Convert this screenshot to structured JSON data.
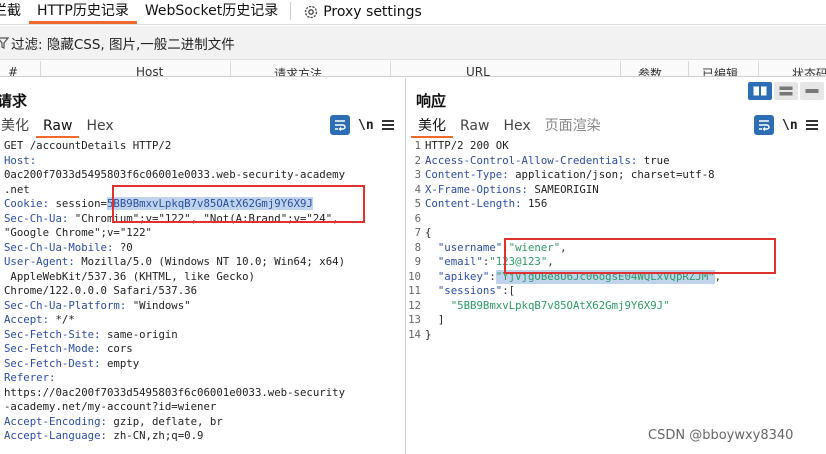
{
  "tabs": [
    {
      "label": "拦截"
    },
    {
      "label": "HTTP历史记录"
    },
    {
      "label": "WebSocket历史记录"
    },
    {
      "label": "Proxy settings"
    }
  ],
  "filter": {
    "text": "过滤: 隐藏CSS, 图片,一般二进制文件"
  },
  "columns": {
    "num": "#",
    "host": "Host",
    "method": "请求方法",
    "url": "URL",
    "params": "参数",
    "edited": "已编辑",
    "status": "状态码"
  },
  "request": {
    "title": "请求",
    "subtabs": [
      "美化",
      "Raw",
      "Hex"
    ],
    "nl_label": "\\n",
    "lines": [
      {
        "text": "GET /accountDetails HTTP/2"
      },
      {
        "name": "Host:",
        "value": ""
      },
      {
        "text": "0ac200f7033d5495803f6c06001e0033.web-security-academy"
      },
      {
        "text": ".net"
      },
      {
        "name": "Cookie:",
        "value": " session=",
        "highlight": "5BB9BmxvLpkqB7v85OAtX62Gmj9Y6X9J"
      },
      {
        "name": "Sec-Ch-Ua:",
        "value": " \"Chromium\";v=\"122\", \"Not(A:Brand\";v=\"24\","
      },
      {
        "text": "\"Google Chrome\";v=\"122\""
      },
      {
        "name": "Sec-Ch-Ua-Mobile:",
        "value": " ?0"
      },
      {
        "name": "User-Agent:",
        "value": " Mozilla/5.0 (Windows NT 10.0; Win64; x64)"
      },
      {
        "text": " AppleWebKit/537.36 (KHTML, like Gecko)"
      },
      {
        "text": "Chrome/122.0.0.0 Safari/537.36"
      },
      {
        "name": "Sec-Ch-Ua-Platform:",
        "value": " \"Windows\""
      },
      {
        "name": "Accept:",
        "value": " */*"
      },
      {
        "name": "Sec-Fetch-Site:",
        "value": " same-origin"
      },
      {
        "name": "Sec-Fetch-Mode:",
        "value": " cors"
      },
      {
        "name": "Sec-Fetch-Dest:",
        "value": " empty"
      },
      {
        "name": "Referer:",
        "value": ""
      },
      {
        "text": "https://0ac200f7033d5495803f6c06001e0033.web-security"
      },
      {
        "text": "-academy.net/my-account?id=wiener"
      },
      {
        "name": "Accept-Encoding:",
        "value": " gzip, deflate, br"
      },
      {
        "name": "Accept-Language:",
        "value": " zh-CN,zh;q=0.9"
      }
    ]
  },
  "response": {
    "title": "响应",
    "subtabs": [
      "美化",
      "Raw",
      "Hex",
      "页面渲染"
    ],
    "nl_label": "\\n",
    "lines": [
      {
        "n": "1",
        "text": "HTTP/2 200 OK"
      },
      {
        "n": "2",
        "name": "Access-Control-Allow-Credentials:",
        "value": " true"
      },
      {
        "n": "3",
        "name": "Content-Type:",
        "value": " application/json; charset=utf-8"
      },
      {
        "n": "4",
        "name": "X-Frame-Options:",
        "value": " SAMEORIGIN"
      },
      {
        "n": "5",
        "name": "Content-Length:",
        "value": " 156"
      },
      {
        "n": "6",
        "text": ""
      },
      {
        "n": "7",
        "text": "{"
      },
      {
        "n": "8",
        "key": "  \"username\"",
        "str": "\"wiener\"",
        "tail": ","
      },
      {
        "n": "9",
        "key": "  \"email\"",
        "str": "\"123@123\"",
        "tail": ","
      },
      {
        "n": "10",
        "key": "  \"apikey\"",
        "strhl": "\"YjVjgOBe8U6Jc06ogsE04WQLxVQpRZJM\"",
        "tail": ","
      },
      {
        "n": "11",
        "key": "  \"sessions\"",
        "tail": "["
      },
      {
        "n": "12",
        "str": "    \"5BB9BmxvLpkqB7v85OAtX62Gmj9Y6X9J\""
      },
      {
        "n": "13",
        "text": "  ]"
      },
      {
        "n": "14",
        "text": "}"
      }
    ]
  },
  "watermark": "CSDN @bboywxy8340",
  "colors": {
    "accent": "#f0682a",
    "blue": "#2d6db4",
    "header": "#2b4ea0",
    "string": "#2e9a66",
    "annotation": "#e03131"
  }
}
